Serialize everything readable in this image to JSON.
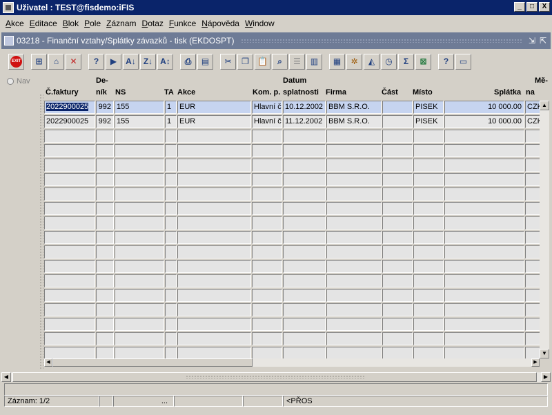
{
  "window": {
    "title": "Uživatel : TEST@fisdemo:iFIS",
    "btn_min": "_",
    "btn_max": "□",
    "btn_close": "X"
  },
  "menu": [
    {
      "label": "Akce"
    },
    {
      "label": "Editace"
    },
    {
      "label": "Blok"
    },
    {
      "label": "Pole"
    },
    {
      "label": "Záznam"
    },
    {
      "label": "Dotaz"
    },
    {
      "label": "Funkce"
    },
    {
      "label": "Nápověda"
    },
    {
      "label": "Window"
    }
  ],
  "subwindow": {
    "title": "03218 - Finanční vztahy/Splátky závazků - tisk (EKDOSPT)"
  },
  "toolbar": {
    "exit_label": "EXIT"
  },
  "nav": {
    "label": "Nav"
  },
  "headers": {
    "cfaktury": "Č.faktury",
    "denik_1": "De-",
    "denik_2": "ník",
    "ns": "NS",
    "ta": "TA",
    "akce": "Akce",
    "kom": "Kom. p.",
    "datum_1": "Datum",
    "datum_2": "splatnosti",
    "firma": "Firma",
    "cast": "Část",
    "misto": "Místo",
    "splatka": "Splátka",
    "mena_1": "Mě-",
    "mena_2": "na"
  },
  "rows": [
    {
      "cfaktury": "2022900025",
      "denik": "992",
      "ns": "155",
      "ta": "1",
      "akce": "EUR",
      "kom": "Hlavní či",
      "datum": "10.12.2002",
      "firma": "BBM S.R.O.",
      "cast": "",
      "misto": "PISEK",
      "splatka": "10 000.00",
      "mena": "CZK"
    },
    {
      "cfaktury": "2022900025",
      "denik": "992",
      "ns": "155",
      "ta": "1",
      "akce": "EUR",
      "kom": "Hlavní či",
      "datum": "11.12.2002",
      "firma": "BBM S.R.O.",
      "cast": "",
      "misto": "PISEK",
      "splatka": "10 000.00",
      "mena": "CZK"
    }
  ],
  "status": {
    "record": "Záznam: 1/2",
    "ellipsis": "...",
    "mode": "<PŘOS"
  }
}
